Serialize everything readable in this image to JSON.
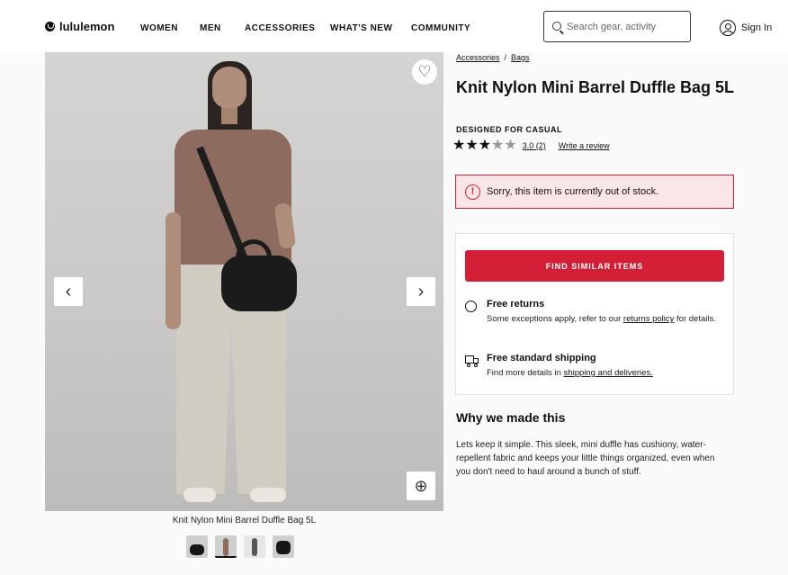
{
  "header": {
    "logo_text": "lululemon",
    "nav": [
      "WOMEN",
      "MEN",
      "ACCESSORIES",
      "WHAT'S NEW",
      "COMMUNITY"
    ],
    "search_placeholder": "Search gear, activity",
    "signin_label": "Sign In"
  },
  "gallery": {
    "caption": "Knit Nylon Mini Barrel Duffle Bag 5L",
    "prev_icon": "‹",
    "next_icon": "›",
    "zoom_icon": "⊕",
    "wishlist_icon": "♡",
    "thumbnail_count": 4,
    "active_thumbnail": 2
  },
  "product": {
    "breadcrumb": [
      "Accessories",
      "Bags"
    ],
    "breadcrumb_sep": "/",
    "title": "Knit Nylon Mini Barrel Duffle Bag 5L",
    "designed_for": "DESIGNED FOR CASUAL",
    "rating_value": "3.0",
    "review_count": "(2)",
    "rating_stars": 3,
    "write_review": "Write a review",
    "out_of_stock": "Sorry, this item is currently out of stock.",
    "alert_icon": "!",
    "find_similar": "FIND SIMILAR ITEMS",
    "returns_title": "Free returns",
    "returns_text_before": "Some exceptions apply, refer to our ",
    "returns_link": "returns policy",
    "returns_text_after": " for details.",
    "shipping_title": "Free standard shipping",
    "shipping_text": "Find more details in ",
    "shipping_link": "shipping and deliveries.",
    "why_title": "Why we made this",
    "why_text": "Lets keep it simple. This sleek, mini duffle has cushiony, water-repellent fabric and keeps your little things organized, even when you don't need to haul around a bunch of stuff."
  },
  "colors": {
    "accent_red": "#d31f35",
    "alert_bg": "#fbe6e7"
  }
}
